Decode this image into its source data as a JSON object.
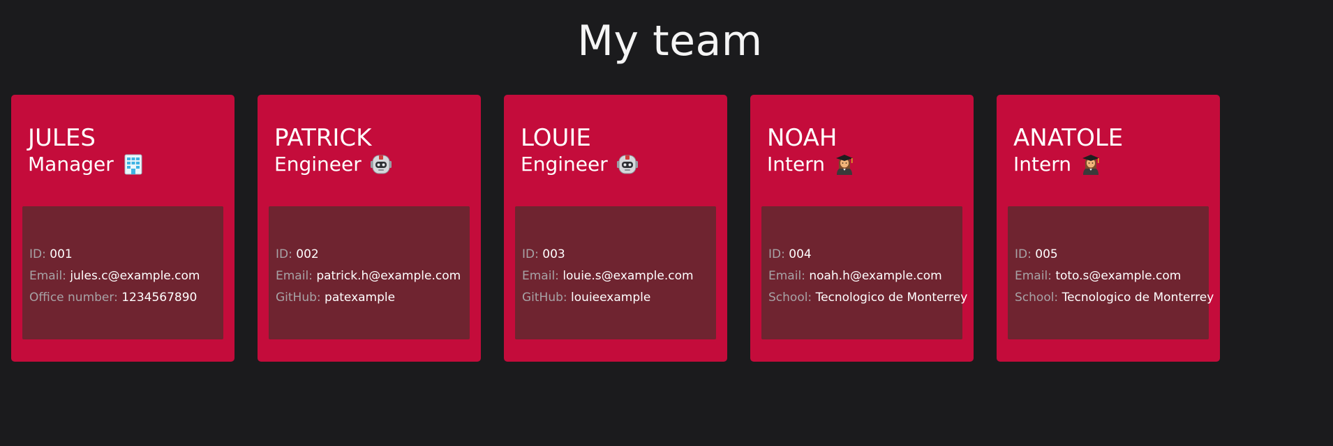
{
  "page": {
    "title": "My team"
  },
  "icons": {
    "manager": "office-building-icon",
    "engineer": "robot-icon",
    "intern": "student-icon"
  },
  "colors": {
    "background": "#1b1b1d",
    "card": "#c40c3b",
    "card_body": "#6f2430",
    "label": "#a7a3a6"
  },
  "team": [
    {
      "name": "JULES",
      "role": "Manager",
      "id_label": "ID:",
      "id": "001",
      "email_label": "Email:",
      "email": "jules.c@example.com",
      "extra_label": "Office number:",
      "extra": "1234567890"
    },
    {
      "name": "PATRICK",
      "role": "Engineer",
      "id_label": "ID:",
      "id": "002",
      "email_label": "Email:",
      "email": "patrick.h@example.com",
      "extra_label": "GitHub:",
      "extra": "patexample"
    },
    {
      "name": "LOUIE",
      "role": "Engineer",
      "id_label": "ID:",
      "id": "003",
      "email_label": "Email:",
      "email": "louie.s@example.com",
      "extra_label": "GitHub:",
      "extra": "louieexample"
    },
    {
      "name": "NOAH",
      "role": "Intern",
      "id_label": "ID:",
      "id": "004",
      "email_label": "Email:",
      "email": "noah.h@example.com",
      "extra_label": "School:",
      "extra": "Tecnologico de Monterrey"
    },
    {
      "name": "ANATOLE",
      "role": "Intern",
      "id_label": "ID:",
      "id": "005",
      "email_label": "Email:",
      "email": "toto.s@example.com",
      "extra_label": "School:",
      "extra": "Tecnologico de Monterrey"
    }
  ]
}
